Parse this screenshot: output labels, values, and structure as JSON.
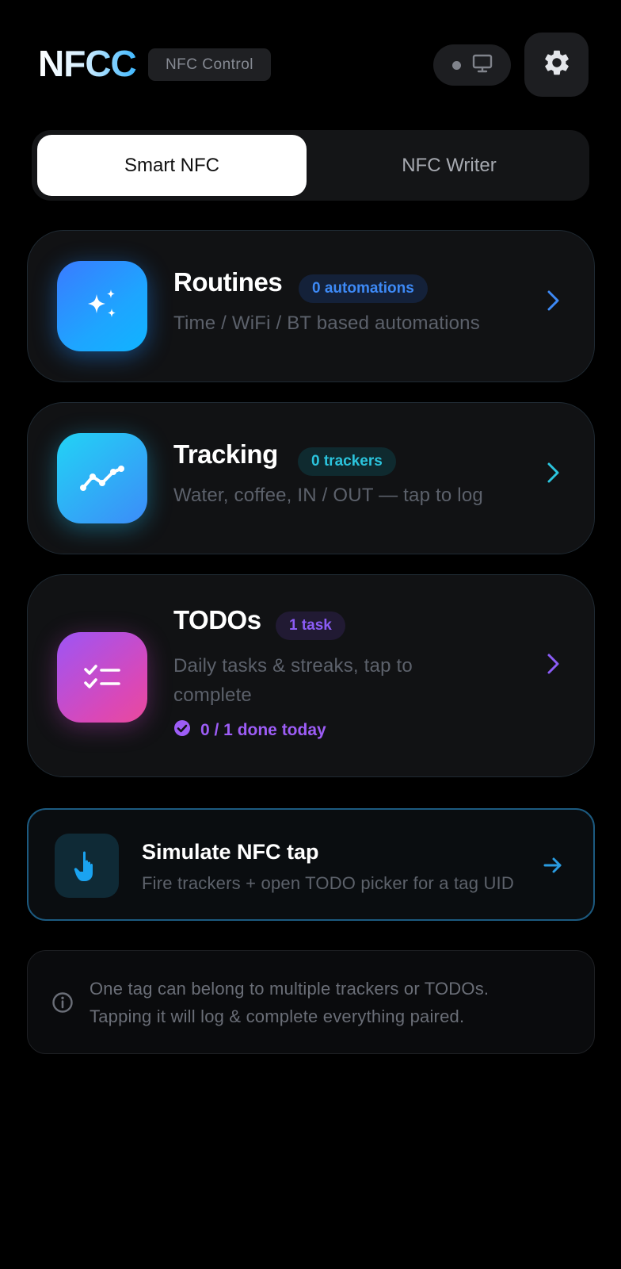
{
  "header": {
    "logo": "NFCC",
    "badge": "NFC Control",
    "device_icon": "monitor-icon",
    "settings_icon": "gear-icon"
  },
  "tabs": [
    {
      "label": "Smart NFC",
      "active": true
    },
    {
      "label": "NFC Writer",
      "active": false
    }
  ],
  "cards": {
    "routines": {
      "title": "Routines",
      "badge": "0 automations",
      "subtitle": "Time / WiFi / BT based automations",
      "icon": "sparkles-icon",
      "accent": "#3d89f5"
    },
    "tracking": {
      "title": "Tracking",
      "badge": "0 trackers",
      "subtitle": "Water, coffee, IN / OUT — tap to log",
      "icon": "trend-line-icon",
      "accent": "#2bc4dd"
    },
    "todos": {
      "title": "TODOs",
      "badge": "1 task",
      "subtitle_line1": "Daily tasks & streaks, tap to",
      "subtitle_line2": "complete",
      "done": "0 / 1 done today",
      "icon": "checklist-icon",
      "accent": "#9d5df6"
    }
  },
  "simulate": {
    "title": "Simulate NFC tap",
    "subtitle": "Fire trackers + open TODO picker for a tag UID",
    "icon": "tap-hand-icon",
    "accent": "#2a9be0"
  },
  "info": {
    "line1": "One tag can belong to multiple trackers or TODOs.",
    "line2": "Tapping it will log & complete everything paired.",
    "icon": "info-icon"
  }
}
